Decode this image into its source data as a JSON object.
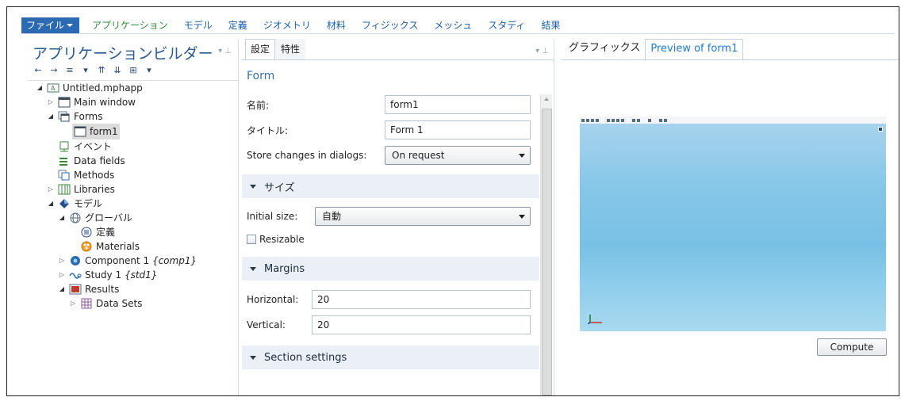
{
  "menu": {
    "file": "ファイル",
    "tabs": [
      "アプリケーション",
      "モデル",
      "定義",
      "ジオメトリ",
      "材料",
      "フィジックス",
      "メッシュ",
      "スタディ",
      "結果"
    ]
  },
  "builder": {
    "title": "アプリケーションビルダー",
    "tree": [
      {
        "label": "Untitled.mphapp",
        "icon": "app-file-icon"
      },
      {
        "label": "Main window",
        "icon": "window-icon"
      },
      {
        "label": "Forms",
        "icon": "forms-icon"
      },
      {
        "label": "form1",
        "icon": "form-icon"
      },
      {
        "label": "イベント",
        "icon": "event-icon"
      },
      {
        "label": "Data fields",
        "icon": "data-fields-icon"
      },
      {
        "label": "Methods",
        "icon": "methods-icon"
      },
      {
        "label": "Libraries",
        "icon": "libraries-icon"
      },
      {
        "label": "モデル",
        "icon": "model-icon"
      },
      {
        "label": "グローバル",
        "icon": "global-icon"
      },
      {
        "label": "定義",
        "icon": "definitions-icon"
      },
      {
        "label": "Materials",
        "icon": "materials-icon"
      },
      {
        "label": "Component 1",
        "tag": "{comp1}",
        "icon": "component-icon"
      },
      {
        "label": "Study 1",
        "tag": "{std1}",
        "icon": "study-icon"
      },
      {
        "label": "Results",
        "icon": "results-icon"
      },
      {
        "label": "Data Sets",
        "icon": "data-sets-icon"
      }
    ]
  },
  "settings": {
    "tabs": [
      "設定",
      "特性"
    ],
    "heading": "Form",
    "name_label": "名前:",
    "name_value": "form1",
    "title_label": "タイトル:",
    "title_value": "Form 1",
    "store_label": "Store changes in dialogs:",
    "store_value": "On request",
    "size_section": "サイズ",
    "initial_size_label": "Initial size:",
    "initial_size_value": "自動",
    "resizable_label": "Resizable",
    "margins_section": "Margins",
    "horizontal_label": "Horizontal:",
    "horizontal_value": "20",
    "vertical_label": "Vertical:",
    "vertical_value": "20",
    "section_settings": "Section settings"
  },
  "graphics": {
    "tabs": [
      "グラフィックス",
      "Preview of form1"
    ],
    "compute_label": "Compute"
  },
  "colors": {
    "accent": "#2b6ab3",
    "canvas_top": "#aad4ee",
    "canvas_mid": "#78c1e6"
  }
}
